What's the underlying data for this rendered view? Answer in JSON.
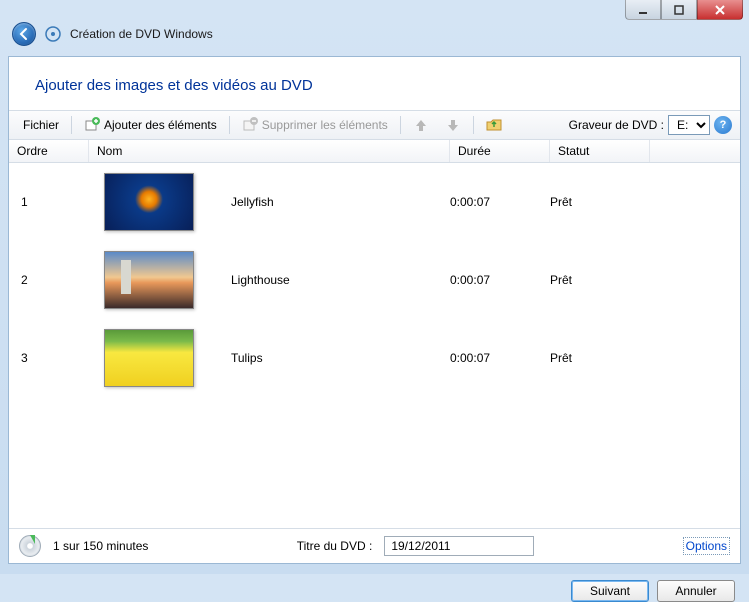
{
  "window": {
    "title": "Création de DVD Windows"
  },
  "page": {
    "heading": "Ajouter des images et des vidéos au DVD"
  },
  "toolbar": {
    "file_label": "Fichier",
    "add_label": "Ajouter des éléments",
    "remove_label": "Supprimer les éléments",
    "burner_label": "Graveur de DVD :",
    "burner_selected": "E:"
  },
  "columns": {
    "order": "Ordre",
    "name": "Nom",
    "duration": "Durée",
    "status": "Statut"
  },
  "items": [
    {
      "order": "1",
      "name": "Jellyfish",
      "duration": "0:00:07",
      "status": "Prêt",
      "thumb": "jelly"
    },
    {
      "order": "2",
      "name": "Lighthouse",
      "duration": "0:00:07",
      "status": "Prêt",
      "thumb": "light"
    },
    {
      "order": "3",
      "name": "Tulips",
      "duration": "0:00:07",
      "status": "Prêt",
      "thumb": "tulips"
    }
  ],
  "status": {
    "usage": "1 sur 150 minutes",
    "title_label": "Titre du DVD :",
    "title_value": "19/12/2011",
    "options_label": "Options"
  },
  "buttons": {
    "next": "Suivant",
    "cancel": "Annuler"
  }
}
